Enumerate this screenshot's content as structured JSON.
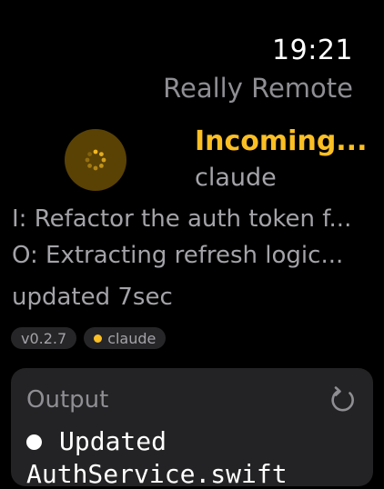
{
  "status_bar": {
    "time": "19:21",
    "app_title": "Really Remote"
  },
  "session": {
    "status": "Incoming...",
    "name": "claude",
    "input_line": "I: Refactor the auth token f...",
    "output_line": "O: Extracting refresh logic...",
    "updated": "updated 7sec",
    "avatar_icon": "spinner-icon",
    "accent_color": "#fbbf24"
  },
  "tags": {
    "version": "v0.2.7",
    "agent": "claude"
  },
  "output_card": {
    "title": "Output",
    "refresh_icon": "refresh-icon",
    "lines": [
      "Updated",
      "AuthService.swift"
    ]
  }
}
